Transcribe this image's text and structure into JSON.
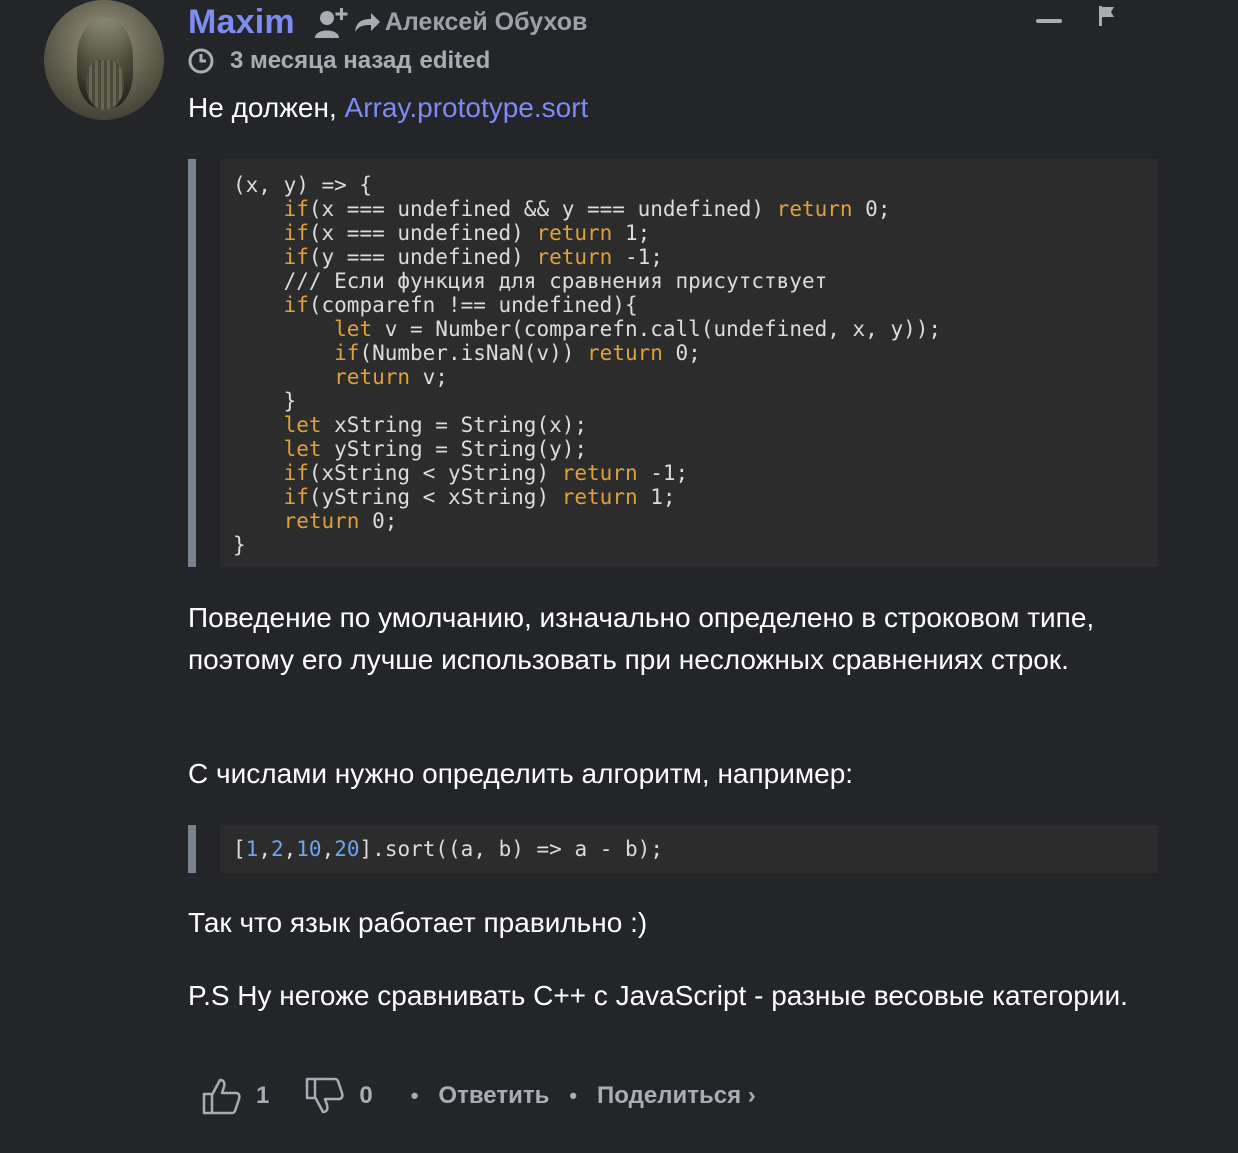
{
  "comment": {
    "author": "Maxim",
    "reply_to": "Алексей Обухов",
    "time": "3 месяца назад",
    "edited": "edited",
    "intro_text": "Не должен, ",
    "intro_link": "Array.prototype.sort",
    "code_block_1": [
      "(x, y) => {",
      "    if(x === undefined && y === undefined) return 0;",
      "    if(x === undefined) return 1;",
      "    if(y === undefined) return -1;",
      "    /// Если функция для сравнения присутствует",
      "    if(comparefn !== undefined){",
      "        let v = Number(comparefn.call(undefined, x, y));",
      "        if(Number.isNaN(v)) return 0;",
      "        return v;",
      "    }",
      "    let xString = String(x);",
      "    let yString = String(y);",
      "    if(xString < yString) return -1;",
      "    if(yString < xString) return 1;",
      "    return 0;",
      "}"
    ],
    "paragraph_2": "Поведение по умолчанию, изначально определено в строковом типе, поэтому его лучше использовать при несложных сравнениях строк.",
    "paragraph_3": "С числами нужно определить алгоритм, например:",
    "code_block_2": "[1,2,10,20].sort((a, b) => a - b);",
    "paragraph_4": "Так что язык работает правильно :)",
    "paragraph_5": "P.S Ну негоже сравнивать C++ с JavaScript - разные весовые категории."
  },
  "actions": {
    "upvotes": "1",
    "downvotes": "0",
    "reply_label": "Ответить",
    "share_label": "Поделиться ›"
  },
  "icons": [
    "avatar",
    "follow-icon",
    "reply-arrow-icon",
    "clock-icon",
    "collapse-icon",
    "flag-icon",
    "thumbs-up-icon",
    "thumbs-down-icon"
  ],
  "colors": {
    "background": "#232529",
    "accent": "#7d8cf2",
    "muted": "#a9adb3",
    "keyword": "#e0a03a",
    "number": "#6aa7f0",
    "code_bg": "#2c2c2c"
  }
}
